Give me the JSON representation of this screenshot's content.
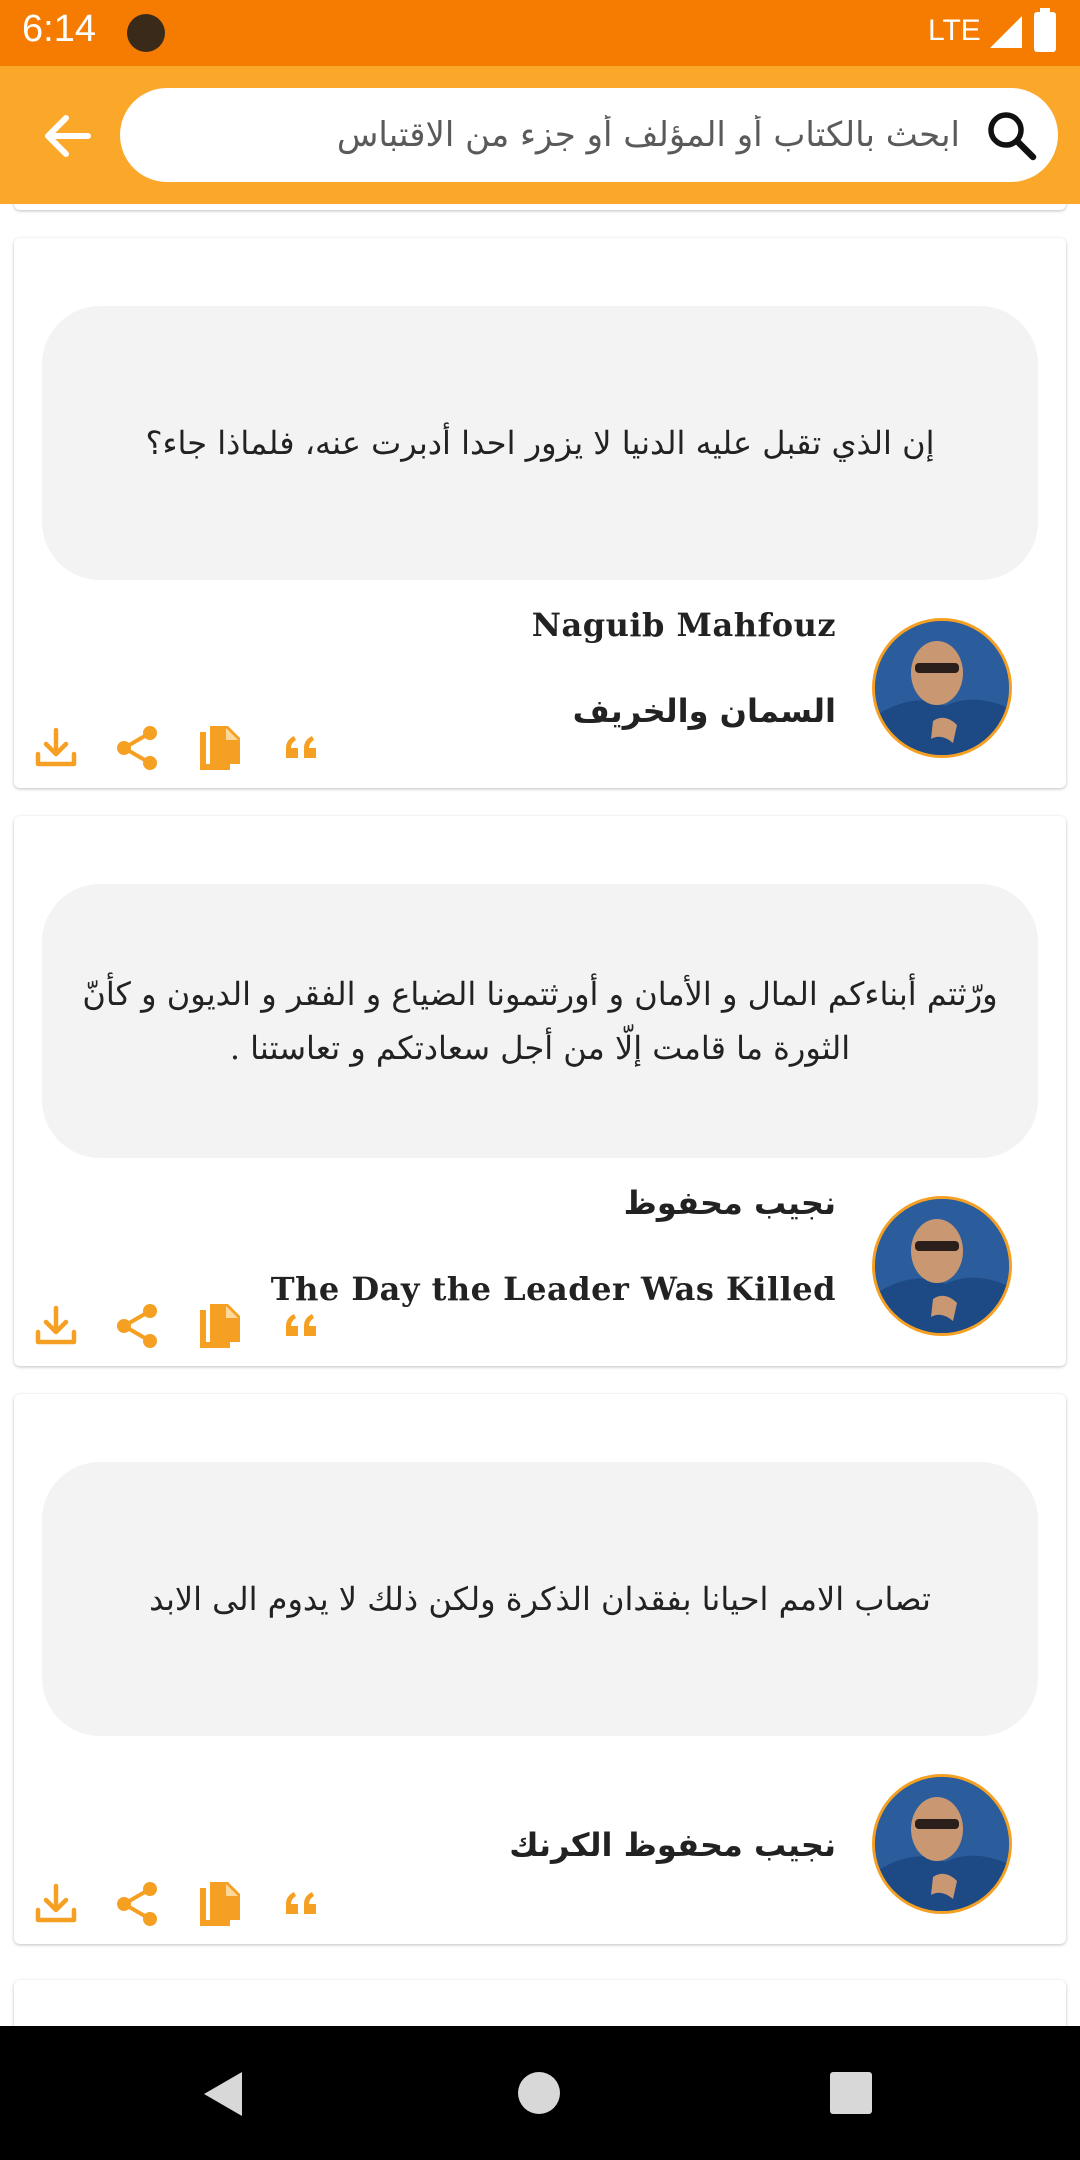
{
  "status_bar": {
    "time": "6:14",
    "network": "LTE"
  },
  "search": {
    "placeholder": "ابحث بالكتاب أو المؤلف أو جزء من الاقتباس",
    "value": ""
  },
  "colors": {
    "status_bar": "#f57c00",
    "app_bar": "#fba72a",
    "accent": "#f5a022",
    "quote_bg": "#f3f3f3"
  },
  "quotes": [
    {
      "text": "إن الذي تقبل عليه الدنيا لا يزور احدا أدبرت عنه، فلماذا جاء؟",
      "line1": "Naguib Mahfouz",
      "line2": "السمان والخريف"
    },
    {
      "text": "ورّثتم أبناءكم المال و الأمان و أورثتمونا الضياع و الفقر و الديون و كأنّ الثورة ما قامت إلّا من أجل سعادتكم و تعاستنا .",
      "line1": "نجيب محفوظ",
      "line2": "The Day the Leader Was Killed"
    },
    {
      "text": "تصاب الامم احيانا بفقدان الذكرة ولكن ذلك لا يدوم الى الابد",
      "line1": "نجيب محفوظ الكرنك"
    }
  ],
  "actions": [
    "download-icon",
    "share-icon",
    "copy-icon",
    "quote-icon"
  ]
}
